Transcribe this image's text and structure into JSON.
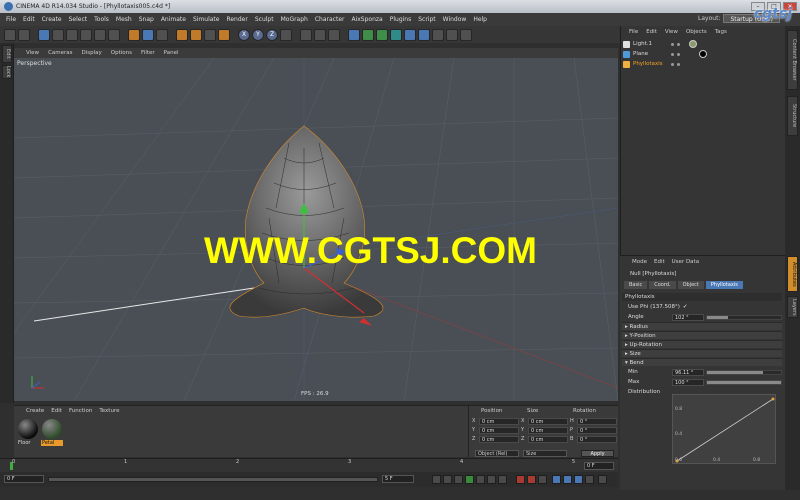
{
  "window": {
    "title": "CINEMA 4D R14.034 Studio - [Phyllotaxis005.c4d *]",
    "buttons": [
      "–",
      "□",
      "×"
    ]
  },
  "menubar": {
    "items": [
      "File",
      "Edit",
      "Create",
      "Select",
      "Tools",
      "Mesh",
      "Snap",
      "Animate",
      "Simulate",
      "Render",
      "Sculpt",
      "MoGraph",
      "Character",
      "AixSponza",
      "Plugins",
      "Script",
      "Window",
      "Help"
    ],
    "layout_label": "Layout:",
    "layout_value": "Startup (User)"
  },
  "watermark_logo": "cgtsj",
  "viewport": {
    "menu": [
      "View",
      "Cameras",
      "Display",
      "Options",
      "Filter",
      "Panel"
    ],
    "label": "Perspective",
    "fps": "FPS : 26.9",
    "watermark": "WWW.CGTSJ.COM"
  },
  "left_tabs": [
    "Edit",
    "Lock"
  ],
  "object_manager": {
    "menu": [
      "File",
      "Edit",
      "View",
      "Objects",
      "Tags"
    ],
    "objects": [
      {
        "name": "Light.1",
        "icon_color": "#e0e0e0",
        "selected": false
      },
      {
        "name": "Plane",
        "icon_color": "#4f9ad8",
        "selected": false
      },
      {
        "name": "Phyllotaxis",
        "icon_color": "#f0b040",
        "selected": true
      }
    ]
  },
  "attributes": {
    "menu": [
      "Mode",
      "Edit",
      "User Data"
    ],
    "object_title": "Null [Phyllotaxis]",
    "tabs": [
      "Basic",
      "Coord.",
      "Object",
      "Phyllotaxis"
    ],
    "active_tab": "Phyllotaxis",
    "section": "Phyllotaxis",
    "use_phi_label": "Use Phi (137.508°)",
    "use_phi_checked": "✓",
    "angle_label": "Angle",
    "angle_value": "102 °",
    "angle_fraction": 0.28,
    "folds": [
      "Radius",
      "Y-Position",
      "Up-Rotation",
      "Size"
    ],
    "bend_label": "Bend",
    "min_label": "Min",
    "min_value": "96.11 °",
    "min_fraction": 0.75,
    "max_label": "Max",
    "max_value": "100 °",
    "max_fraction": 1.0,
    "distribution_label": "Distribution",
    "spline_ticks": {
      "y": [
        "0.8",
        "0.4"
      ],
      "x": [
        "0.0",
        "0.4",
        "0.8"
      ]
    }
  },
  "right_tabs": [
    "Content Browser",
    "Structure",
    "Attributes",
    "Layers"
  ],
  "material_manager": {
    "menu": [
      "Create",
      "Edit",
      "Function",
      "Texture"
    ],
    "materials": [
      {
        "name": "Floor",
        "color": "#0a0a0a",
        "active": false
      },
      {
        "name": "Petal",
        "color": "#2e4a2a",
        "active": true
      }
    ]
  },
  "coordinates": {
    "headers": [
      "Position",
      "Size",
      "Rotation"
    ],
    "rows": [
      {
        "pos_axis": "X",
        "pos": "0 cm",
        "size_axis": "X",
        "size": "0 cm",
        "rot_axis": "H",
        "rot": "0 °"
      },
      {
        "pos_axis": "Y",
        "pos": "0 cm",
        "size_axis": "Y",
        "size": "0 cm",
        "rot_axis": "P",
        "rot": "0 °"
      },
      {
        "pos_axis": "Z",
        "pos": "0 cm",
        "size_axis": "Z",
        "size": "0 cm",
        "rot_axis": "B",
        "rot": "0 °"
      }
    ],
    "mode": "Object (Rel)",
    "size_mode": "Size",
    "apply": "Apply"
  },
  "timeline": {
    "ticks": [
      "0",
      "1",
      "2",
      "3",
      "4",
      "5"
    ],
    "current_frame": "0 F",
    "start": "0 F",
    "end": "5 F",
    "end2": "5 F",
    "current_right": "0 F"
  }
}
